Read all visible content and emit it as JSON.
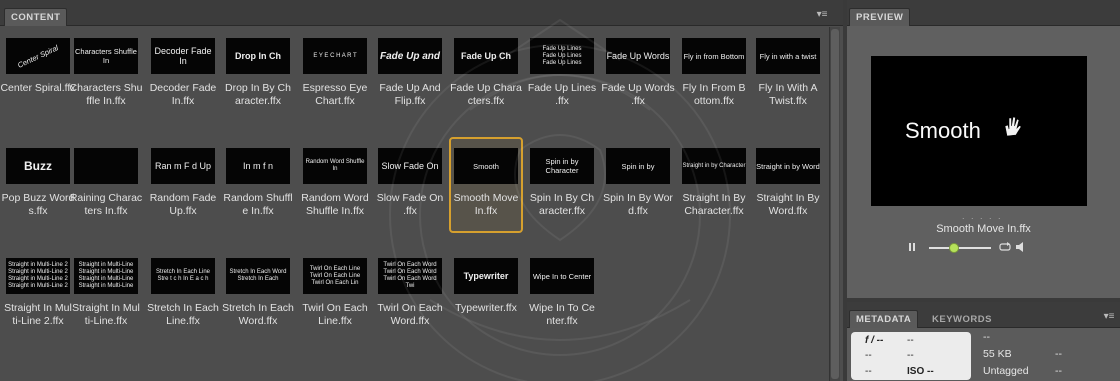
{
  "content_panel": {
    "tab_label": "CONTENT",
    "menu_icon": "panel-menu-icon",
    "items": [
      {
        "caption": "Center Spiral.ffx",
        "thumb_text": "Center Spiral",
        "style": "spiral"
      },
      {
        "caption": "Characters Shu\nffle In.ffx",
        "thumb_text": "Characters Shuffle In",
        "style": "sm"
      },
      {
        "caption": "Decoder Fade\nIn.ffx",
        "thumb_text": "Decoder Fade In",
        "style": "md"
      },
      {
        "caption": "Drop In By Ch\naracter.ffx",
        "thumb_text": "Drop In Ch",
        "style": "md-bold"
      },
      {
        "caption": "Espresso Eye\nChart.ffx",
        "thumb_text": "E Y E  C H A R T",
        "style": "xs"
      },
      {
        "caption": "Fade Up And\nFlip.ffx",
        "thumb_text": "Fade Up and",
        "style": "bi"
      },
      {
        "caption": "Fade Up Chara\ncters.ffx",
        "thumb_text": "Fade Up Ch",
        "style": "md-bold"
      },
      {
        "caption": "Fade Up Lines\n.ffx",
        "thumb_text": "Fade Up Lines\nFade Up Lines\nFade Up Lines",
        "style": "xs"
      },
      {
        "caption": "Fade Up Words\n.ffx",
        "thumb_text": "Fade Up Words",
        "style": "md"
      },
      {
        "caption": "Fly In From B\nottom.ffx",
        "thumb_text": "Fly in from Bottom",
        "style": "sm"
      },
      {
        "caption": "Fly In With A\nTwist.ffx",
        "thumb_text": "Fly in with a twist",
        "style": "sm"
      },
      {
        "caption": "Pop Buzz Word\ns.ffx",
        "thumb_text": "Buzz",
        "style": "lg"
      },
      {
        "caption": "Raining Charac\nters In.ffx",
        "thumb_text": "",
        "style": "matrix"
      },
      {
        "caption": "Random Fade\nUp.ffx",
        "thumb_text": "Ran  m F d  Up",
        "style": "md"
      },
      {
        "caption": "Random Shuffl\ne In.ffx",
        "thumb_text": "In  m    f   n",
        "style": "md"
      },
      {
        "caption": "Random Word\nShuffle In.ffx",
        "thumb_text": "Random Word Shuffle In",
        "style": "xs"
      },
      {
        "caption": "Slow Fade On\n.ffx",
        "thumb_text": "Slow Fade On",
        "style": "md"
      },
      {
        "caption": "Smooth Move\nIn.ffx",
        "thumb_text": "Smooth",
        "style": "sm",
        "selected": true
      },
      {
        "caption": "Spin In By Ch\naracter.ffx",
        "thumb_text": "Spin in by Character",
        "style": "sm"
      },
      {
        "caption": "Spin In By Wor\nd.ffx",
        "thumb_text": "Spin in by",
        "style": "sm"
      },
      {
        "caption": "Straight In By\nCharacter.ffx",
        "thumb_text": "Straight in by Character",
        "style": "xs"
      },
      {
        "caption": "Straight In By\nWord.ffx",
        "thumb_text": "Straight in by Word",
        "style": "sm"
      },
      {
        "caption": "Straight In Mul\nti-Line 2.ffx",
        "thumb_text": "Straight in Multi-Line 2\nStraight in Multi-Line 2\nStraight in Multi-Line 2\nStraight in Multi-Line 2",
        "style": "xs"
      },
      {
        "caption": "Straight In Mul\nti-Line.ffx",
        "thumb_text": "Straight in Multi-Line\nStraight in Multi-Line\nStraight in Multi-Line\nStraight in Multi-Line",
        "style": "xs"
      },
      {
        "caption": "Stretch In Each\nLine.ffx",
        "thumb_text": "Stretch In Each Line\nStre t c h In E a c h",
        "style": "xs"
      },
      {
        "caption": "Stretch In Each\nWord.ffx",
        "thumb_text": "Stretch In Each Word\nStretch  In   Each",
        "style": "xs"
      },
      {
        "caption": "Twirl On Each\nLine.ffx",
        "thumb_text": "Twirl On Each Line\nTwirl On Each Line\nTwirl On Each Lin",
        "style": "xs"
      },
      {
        "caption": "Twirl On Each\nWord.ffx",
        "thumb_text": "Twirl On Each Word\nTwirl On Each Word\nTwirl On Each Word\nTwi",
        "style": "xs"
      },
      {
        "caption": "Typewriter.ffx",
        "thumb_text": "Typewriter",
        "style": "md-bold"
      },
      {
        "caption": "Wipe In To Ce\nnter.ffx",
        "thumb_text": "Wipe In to Center",
        "style": "sm"
      }
    ]
  },
  "preview_panel": {
    "tab_label": "PREVIEW",
    "preview_text": "Smooth",
    "preview_dots": ". . . . .",
    "file_name": "Smooth Move In.ffx",
    "slider_position": 0.4
  },
  "metadata_panel": {
    "tabs": [
      "METADATA",
      "KEYWORDS"
    ],
    "aperture": "f / --",
    "aperture_value": "--",
    "row2_left": "--",
    "row2_mid": "--",
    "row3_left": "--",
    "iso": "ISO --",
    "right_top": "--",
    "file_size": "55 KB",
    "file_size_extra": "--",
    "label": "Untagged",
    "label_extra": "--"
  }
}
